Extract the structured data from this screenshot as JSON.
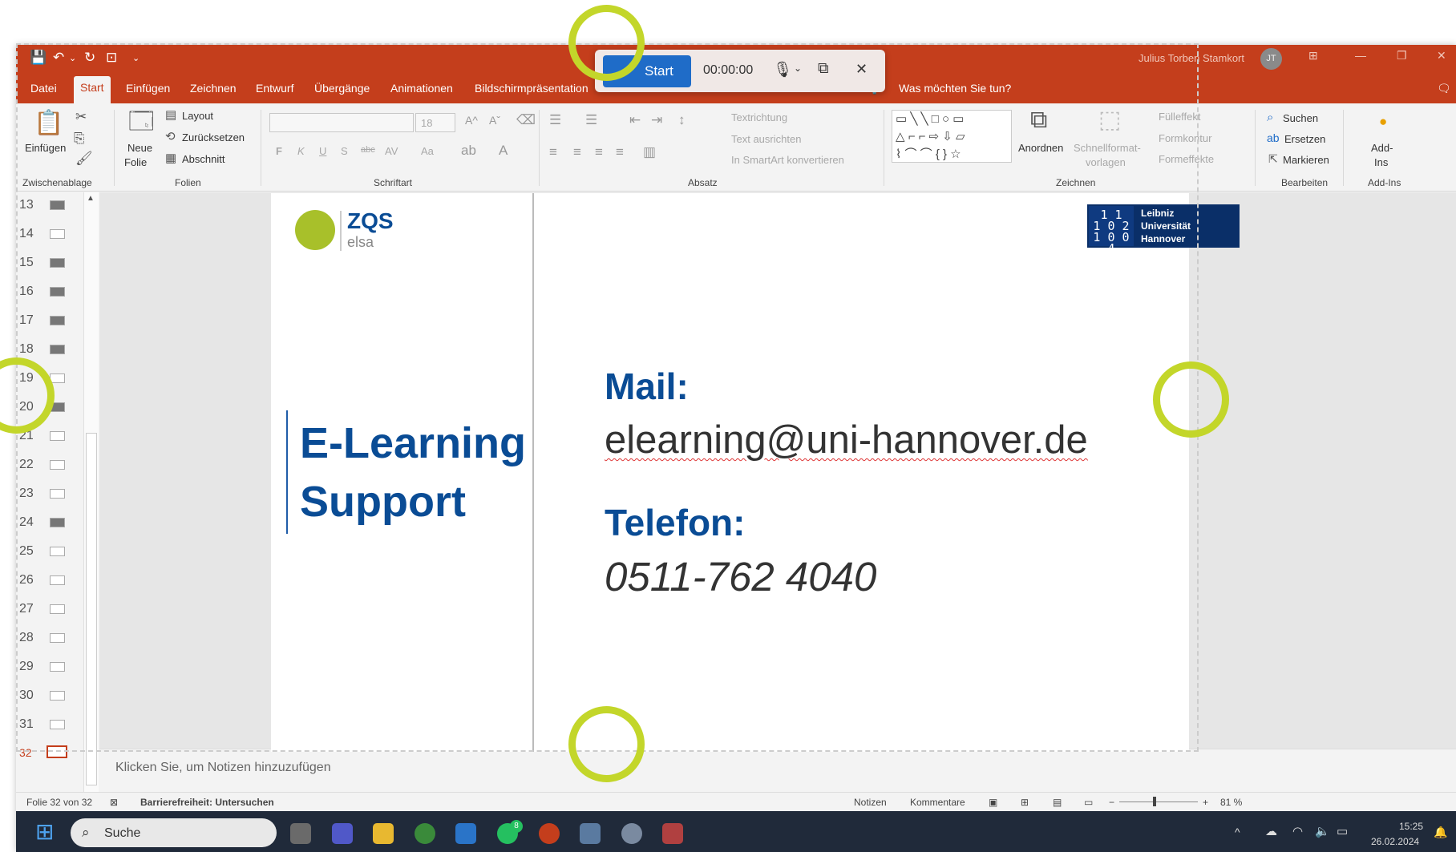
{
  "titlebar": {
    "user_name": "Julius Torben Stamkort",
    "avatar_initials": "JT"
  },
  "recorder": {
    "start_label": "Start",
    "timer": "00:00:00"
  },
  "tabs": [
    "Datei",
    "Start",
    "Einfügen",
    "Zeichnen",
    "Entwurf",
    "Übergänge",
    "Animationen",
    "Bildschirmpräsentation"
  ],
  "tell_me": "Was möchten Sie tun?",
  "ribbon": {
    "clipboard": {
      "paste": "Einfügen",
      "group": "Zwischenablage"
    },
    "slides": {
      "new_slide": "Neue",
      "new_slide2": "Folie",
      "layout": "Layout",
      "reset": "Zurücksetzen",
      "section": "Abschnitt",
      "group": "Folien"
    },
    "font": {
      "size": "18",
      "group": "Schriftart",
      "bold": "F",
      "italic": "K",
      "underline": "U",
      "shadow": "S",
      "strike": "abc",
      "spacing": "AV",
      "case": "Aa"
    },
    "paragraph": {
      "text_direction": "Textrichtung",
      "align_text": "Text ausrichten",
      "smartart": "In SmartArt konvertieren",
      "group": "Absatz"
    },
    "drawing": {
      "arrange": "Anordnen",
      "quick_styles": "Schnellformat-",
      "quick_styles2": "vorlagen",
      "fill": "Fülleffekt",
      "outline": "Formkontur",
      "effects": "Formeffekte",
      "group": "Zeichnen"
    },
    "editing": {
      "find": "Suchen",
      "replace": "Ersetzen",
      "select": "Markieren",
      "group": "Bearbeiten"
    },
    "addins": {
      "label": "Add-",
      "label2": "Ins",
      "group": "Add-Ins"
    }
  },
  "slide_numbers": [
    "13",
    "14",
    "15",
    "16",
    "17",
    "18",
    "19",
    "20",
    "21",
    "22",
    "23",
    "24",
    "25",
    "26",
    "27",
    "28",
    "29",
    "30",
    "31",
    "32"
  ],
  "slide": {
    "logo_top": "ZQS",
    "logo_bottom": "elsa",
    "headline_1": "E-Learning",
    "headline_2": "Support",
    "mail_label": "Mail:",
    "email": "elearning@uni-hannover.de",
    "phone_label": "Telefon:",
    "phone": "0511-762 4040",
    "luh_digits": "1 1\n1 0 2\n1 0 0 4",
    "luh_1": "Leibniz",
    "luh_2": "Universität",
    "luh_3": "Hannover"
  },
  "notes_placeholder": "Klicken Sie, um Notizen hinzuzufügen",
  "status": {
    "slide_count": "Folie 32 von 32",
    "accessibility": "Barrierefreiheit: Untersuchen",
    "notes": "Notizen",
    "comments": "Kommentare",
    "zoom": "81 %"
  },
  "taskbar": {
    "search": "Suche",
    "time": "15:25",
    "date": "26.02.2024",
    "badge": "8"
  },
  "colors": {
    "accent": "#c43e1c",
    "brand_blue": "#0a4c95",
    "ring": "#c3d62a"
  }
}
